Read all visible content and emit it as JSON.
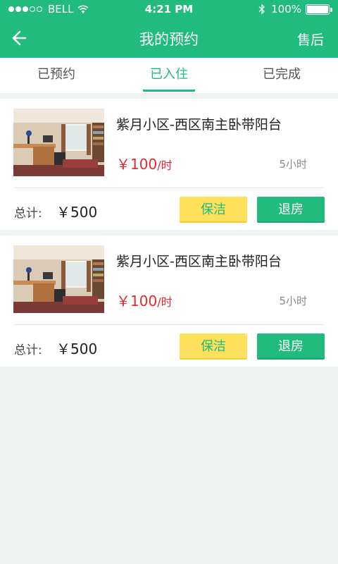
{
  "status_bar": {
    "carrier": "BELL",
    "time": "4:21 PM",
    "battery": "100%"
  },
  "nav": {
    "title": "我的预约",
    "right_action": "售后"
  },
  "tabs": [
    {
      "label": "已预约",
      "active": false
    },
    {
      "label": "已入住",
      "active": true
    },
    {
      "label": "已完成",
      "active": false
    }
  ],
  "bookings": [
    {
      "name": "紫月小区-西区南主卧带阳台",
      "price": "￥100",
      "price_unit": "/时",
      "duration": "5小时",
      "total_label": "总计:",
      "total_value": "￥500",
      "clean_label": "保洁",
      "return_label": "退房"
    },
    {
      "name": "紫月小区-西区南主卧带阳台",
      "price": "￥100",
      "price_unit": "/时",
      "duration": "5小时",
      "total_label": "总计:",
      "total_value": "￥500",
      "clean_label": "保洁",
      "return_label": "退房"
    }
  ],
  "colors": {
    "brand_green": "#21bb7d",
    "price_red": "#e6292e",
    "clean_yellow": "#fde05b"
  }
}
